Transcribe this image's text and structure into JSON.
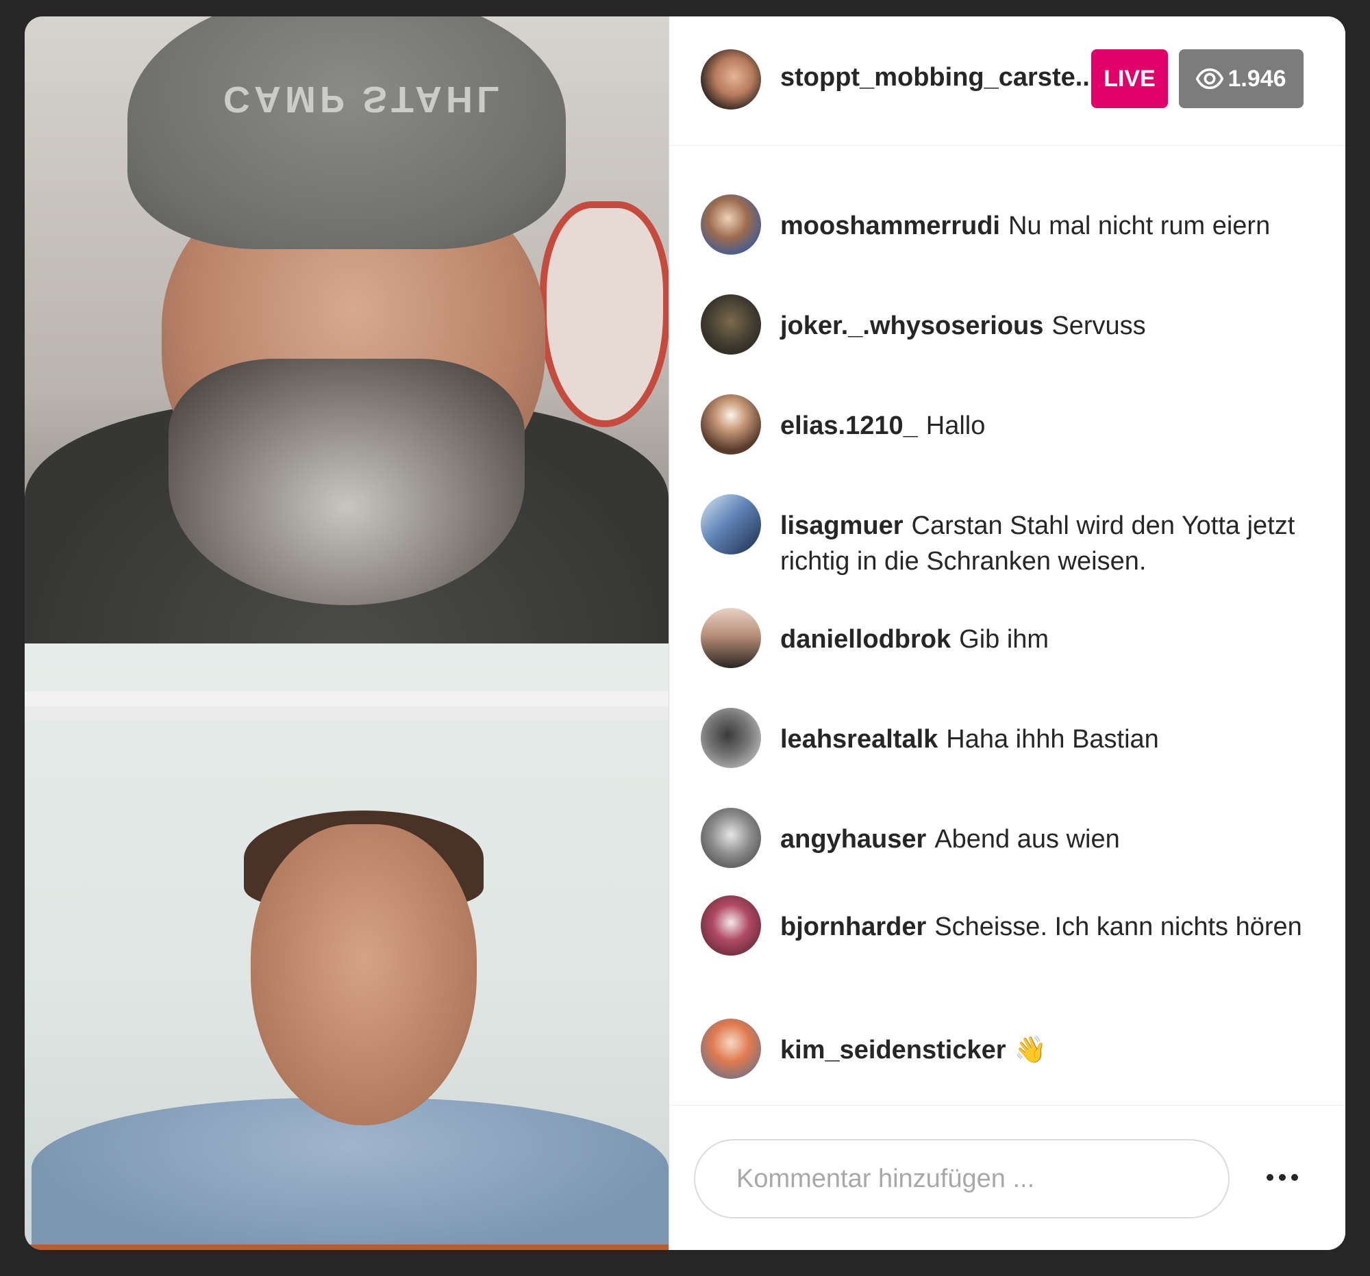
{
  "header": {
    "username": "stoppt_mobbing_carste..",
    "live_label": "LIVE",
    "viewer_count": "1.946",
    "icons": {
      "viewers": "eye-icon"
    }
  },
  "video": {
    "top_overlay_text": "CAMP STAHL"
  },
  "comments": [
    {
      "user": "mooshammerrudi",
      "text": "Nu mal nicht rum eiern"
    },
    {
      "user": "joker._.whysoserious",
      "text": "Servuss"
    },
    {
      "user": "elias.1210_",
      "text": "Hallo"
    },
    {
      "user": "lisagmuer",
      "text": "Carstan Stahl wird den Yotta jetzt richtig in die Schranken weisen."
    },
    {
      "user": "daniellodbrok",
      "text": "Gib ihm"
    },
    {
      "user": "leahsrealtalk",
      "text": "Haha ihhh Bastian"
    },
    {
      "user": "angyhauser",
      "text": "Abend aus wien"
    },
    {
      "user": "bjornharder",
      "text": "Scheisse. Ich kann nichts hören"
    },
    {
      "user": "kim_seidensticker",
      "text": "👋"
    }
  ],
  "composer": {
    "placeholder": "Kommentar hinzufügen ...",
    "icons": {
      "more": "more-options-icon"
    }
  },
  "colors": {
    "live_badge": "#e1006a",
    "viewer_badge": "#7c7c7c",
    "text_primary": "#262626",
    "placeholder": "#a8a8a8"
  }
}
